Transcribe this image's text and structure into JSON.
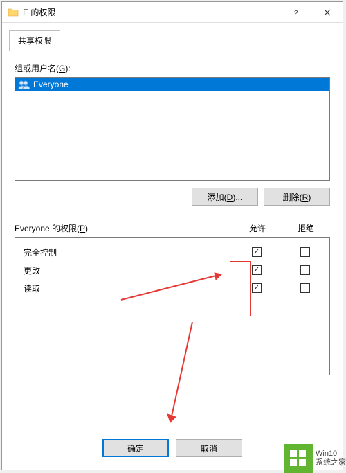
{
  "window": {
    "title": "E 的权限"
  },
  "tabs": {
    "share_permissions": "共享权限"
  },
  "groups_label_pre": "组或用户名(",
  "groups_label_key": "G",
  "groups_label_post": "):",
  "principals": [
    {
      "name": "Everyone",
      "selected": true
    }
  ],
  "buttons": {
    "add_pre": "添加(",
    "add_key": "D",
    "add_post": ")...",
    "remove_pre": "删除(",
    "remove_key": "R",
    "remove_post": ")",
    "ok": "确定",
    "cancel": "取消"
  },
  "perm_header_pre": "Everyone 的权限(",
  "perm_header_key": "P",
  "perm_header_post": ")",
  "col_allow": "允许",
  "col_deny": "拒绝",
  "permissions": [
    {
      "name": "完全控制",
      "allow": true,
      "deny": false
    },
    {
      "name": "更改",
      "allow": true,
      "deny": false
    },
    {
      "name": "读取",
      "allow": true,
      "deny": false
    }
  ],
  "watermark": {
    "line1": "Win10",
    "line2": "系统之家"
  }
}
